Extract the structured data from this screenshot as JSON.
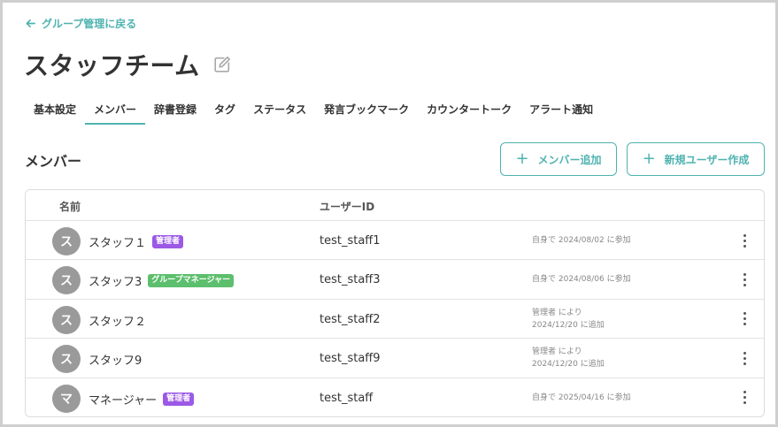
{
  "back_link": {
    "label": "グループ管理に戻る",
    "icon": "arrow-left-icon"
  },
  "page": {
    "title": "スタッフチーム",
    "edit_icon": "pencil-icon"
  },
  "tabs": [
    {
      "label": "基本設定",
      "active": false
    },
    {
      "label": "メンバー",
      "active": true
    },
    {
      "label": "辞書登録",
      "active": false
    },
    {
      "label": "タグ",
      "active": false
    },
    {
      "label": "ステータス",
      "active": false
    },
    {
      "label": "発言ブックマーク",
      "active": false
    },
    {
      "label": "カウンタートーク",
      "active": false
    },
    {
      "label": "アラート通知",
      "active": false
    }
  ],
  "section": {
    "title": "メンバー",
    "add_member_label": "メンバー追加",
    "create_user_label": "新規ユーザー作成"
  },
  "table": {
    "headers": {
      "name": "名前",
      "user_id": "ユーザーID"
    },
    "rows": [
      {
        "avatar": "ス",
        "name": "スタッフ１",
        "badge": "管理者",
        "badge_type": "admin",
        "user_id": "test_staff1",
        "status_line1": "自身で 2024/08/02 に参加",
        "status_line2": ""
      },
      {
        "avatar": "ス",
        "name": "スタッフ3",
        "badge": "グループマネージャー",
        "badge_type": "manager",
        "user_id": "test_staff3",
        "status_line1": "自身で 2024/08/06 に参加",
        "status_line2": ""
      },
      {
        "avatar": "ス",
        "name": "スタッフ２",
        "badge": "",
        "badge_type": "",
        "user_id": "test_staff2",
        "status_line1": "管理者 により",
        "status_line2": "2024/12/20 に追加"
      },
      {
        "avatar": "ス",
        "name": "スタッフ9",
        "badge": "",
        "badge_type": "",
        "user_id": "test_staff9",
        "status_line1": "管理者 により",
        "status_line2": "2024/12/20 に追加"
      },
      {
        "avatar": "マ",
        "name": "マネージャー",
        "badge": "管理者",
        "badge_type": "admin",
        "user_id": "test_staff",
        "status_line1": "自身で 2025/04/16 に参加",
        "status_line2": ""
      }
    ]
  },
  "colors": {
    "accent": "#4fb3b0",
    "admin_badge": "#9b59e6",
    "manager_badge": "#5cbf6d",
    "avatar": "#9a9a9a"
  }
}
